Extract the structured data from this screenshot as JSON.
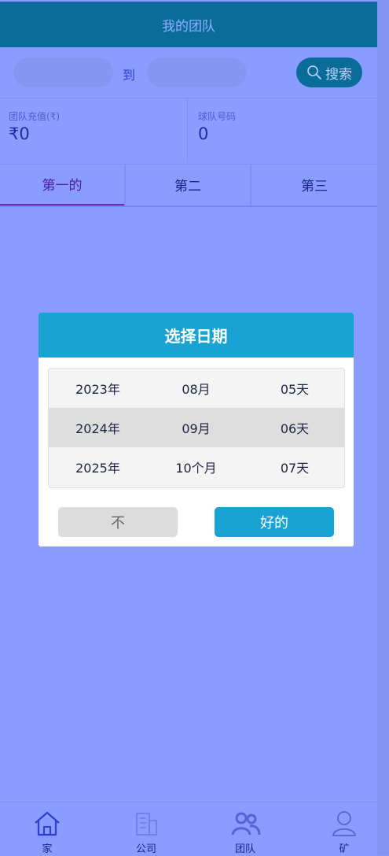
{
  "header": {
    "title": "我的团队"
  },
  "search": {
    "from_value": "",
    "to_label": "到",
    "to_value": "",
    "button_label": "搜索"
  },
  "stats": [
    {
      "label": "团队充值(₹)",
      "value": "₹0"
    },
    {
      "label": "球队号码",
      "value": "0"
    }
  ],
  "tabs": [
    {
      "label": "第一的",
      "active": true
    },
    {
      "label": "第二",
      "active": false
    },
    {
      "label": "第三",
      "active": false
    }
  ],
  "dialog": {
    "title": "选择日期",
    "rows": [
      {
        "year": "2023年",
        "month": "08月",
        "day": "05天"
      },
      {
        "year": "2024年",
        "month": "09月",
        "day": "06天",
        "selected": true
      },
      {
        "year": "2025年",
        "month": "10个月",
        "day": "07天"
      }
    ],
    "cancel_label": "不",
    "ok_label": "好的"
  },
  "nav": [
    {
      "label": "家",
      "icon": "home-icon"
    },
    {
      "label": "公司",
      "icon": "building-icon"
    },
    {
      "label": "团队",
      "icon": "team-icon"
    },
    {
      "label": "矿",
      "icon": "user-icon"
    }
  ],
  "colors": {
    "header_bg": "#0a6c99",
    "page_bg": "#8a9cff",
    "dialog_accent": "#19a3d3"
  }
}
